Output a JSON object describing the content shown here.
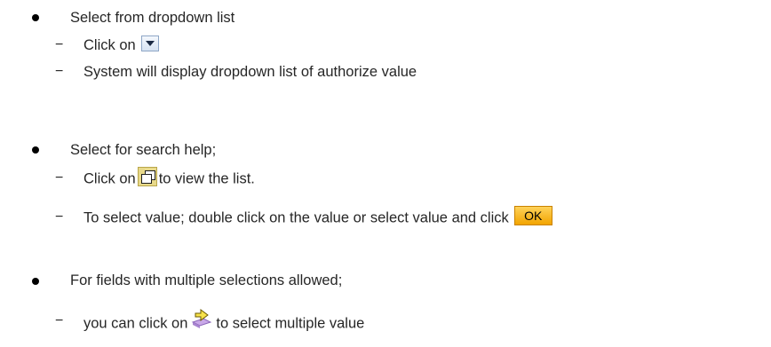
{
  "bullets": [
    {
      "title": "Select from dropdown list",
      "steps": [
        {
          "prefix": "Click on",
          "icon": "dropdown-arrow-icon",
          "suffix": ""
        },
        {
          "text": "System will display dropdown list of authorize value"
        }
      ]
    },
    {
      "title": "Select for search help;",
      "steps": [
        {
          "prefix": "Click on",
          "icon": "search-help-icon",
          "suffix": "to view the list."
        },
        {
          "prefix": "To select value; double click on the value or select  value and click",
          "button": "OK"
        }
      ]
    },
    {
      "title": "For fields with multiple selections allowed;",
      "steps": [
        {
          "prefix": "you can click on",
          "icon": "multiple-selection-arrow-icon",
          "suffix": "to select multiple value"
        }
      ]
    }
  ],
  "dash_symbol": "−"
}
